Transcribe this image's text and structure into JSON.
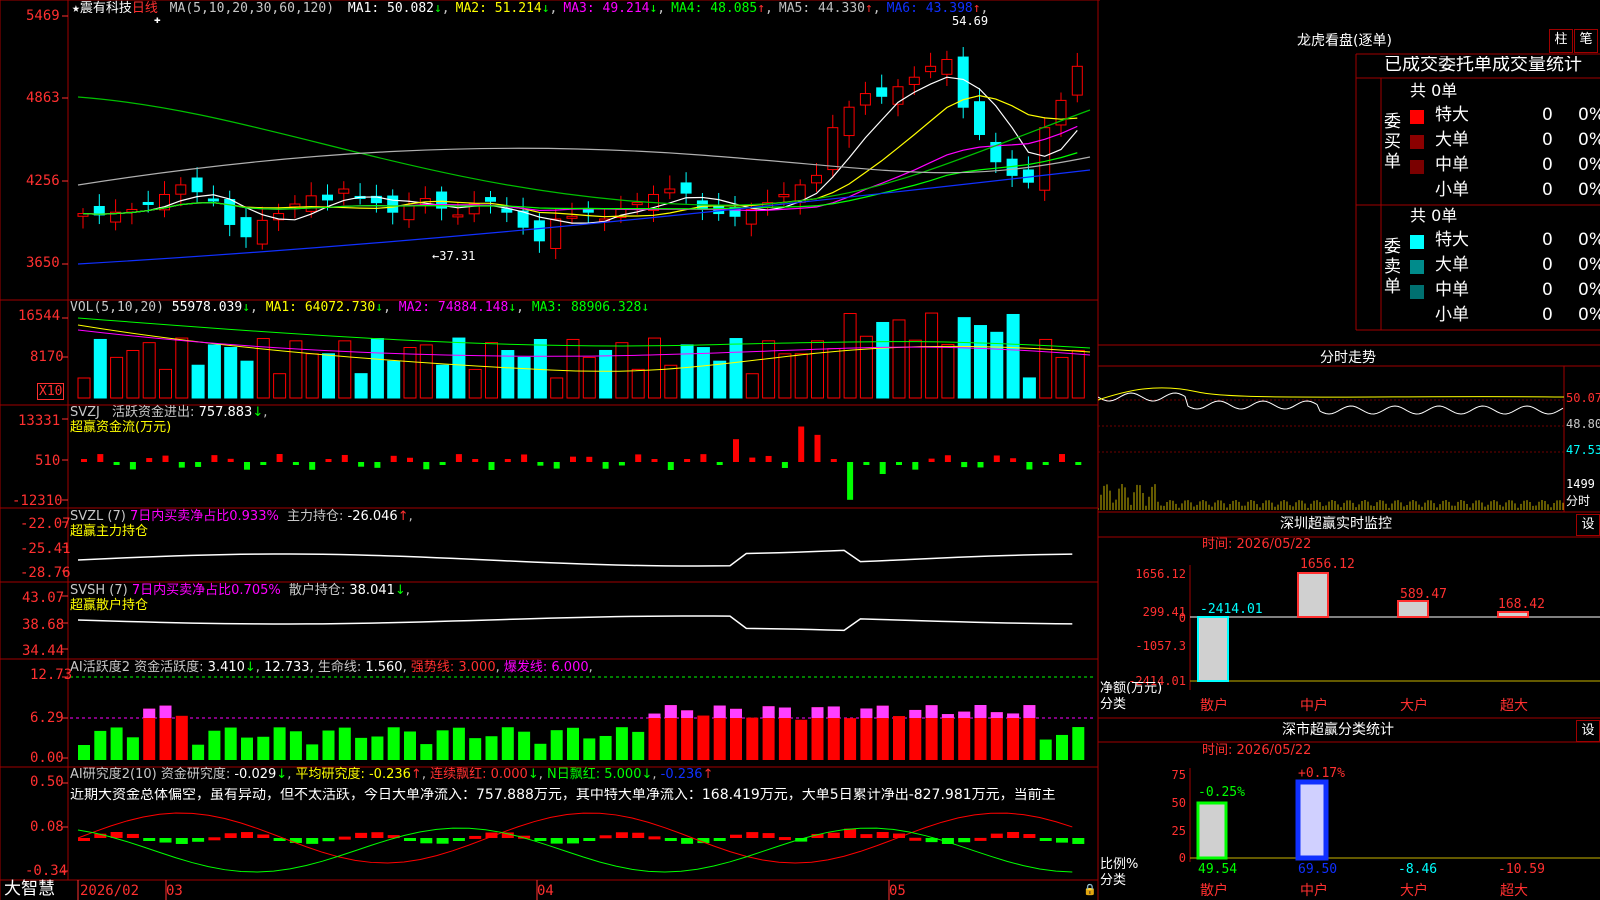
{
  "stock": {
    "name": "★震有科技",
    "period": "日线",
    "ma_spec": "MA(5,10,20,30,60,120)"
  },
  "ma": [
    {
      "label": "MA1:",
      "value": "50.082",
      "arrow": "↓",
      "color": "#ffffff"
    },
    {
      "label": "MA2:",
      "value": "51.214",
      "arrow": "↓",
      "color": "#ffff00"
    },
    {
      "label": "MA3:",
      "value": "49.214",
      "arrow": "↓",
      "color": "#ff00ff"
    },
    {
      "label": "MA4:",
      "value": "48.085",
      "arrow": "↑",
      "color": "#00ff00"
    },
    {
      "label": "MA5:",
      "value": "44.330",
      "arrow": "↑",
      "color": "#c0c0c0"
    },
    {
      "label": "MA6:",
      "value": "43.398",
      "arrow": "↑",
      "color": "#1030ff"
    }
  ],
  "price_axis": [
    "5469",
    "4863",
    "4256",
    "3650"
  ],
  "price_high_label": "54.69",
  "price_low_label": "←37.31",
  "vol": {
    "spec": "VOL(5,10,20)",
    "value": "55978.039",
    "arrow": "↓",
    "ma1": "MA1: 64072.730",
    "ma1_arrow": "↓",
    "ma2": "MA2: 74884.148",
    "ma2_arrow": "↓",
    "ma3": "MA3: 88906.328",
    "ma3_arrow": "↓",
    "axis": [
      "16544",
      "8170"
    ],
    "unit": "X10"
  },
  "svzj": {
    "title": "SVZJ",
    "label": "活跃资金进出:",
    "value": "757.883",
    "arrow": "↓",
    "subtitle": "超赢资金流(万元)",
    "axis": [
      "13331",
      "510",
      "-12310"
    ]
  },
  "svzl": {
    "title": "SVZL (7)",
    "label": "7日内买卖净占比0.933%",
    "label2": "主力持仓:",
    "value": "-26.046",
    "arrow": "↑",
    "subtitle": "超赢主力持仓",
    "axis": [
      "-22.07",
      "-25.41",
      "-28.76"
    ]
  },
  "svsh": {
    "title": "SVSH (7)",
    "label": "7日内买卖净占比0.705%",
    "label2": "散户持仓:",
    "value": "38.041",
    "arrow": "↓",
    "subtitle": "超赢散户持仓",
    "axis": [
      "43.07",
      "38.68",
      "34.44"
    ]
  },
  "ai1": {
    "title": "AI活跃度2",
    "label": "资金活跃度:",
    "value": "3.410",
    "arrow": "↓",
    "v2": "12.733",
    "label3": "生命线:",
    "v3": "1.560",
    "label4": "强势线:",
    "v4": "3.000",
    "label5": "爆发线:",
    "v5": "6.000",
    "axis": [
      "12.73",
      "6.29",
      "0.00"
    ]
  },
  "ai2": {
    "title": "AI研究度2(10)",
    "label": "资金研究度:",
    "value": "-0.029",
    "arrow": "↓",
    "label2": "平均研究度:",
    "v2": "-0.236",
    "label3": "连续飘红:",
    "v3": "0.000",
    "label4": "N日飘红:",
    "v4": "5.000",
    "v5": "-0.236",
    "axis": [
      "0.50",
      "0.08",
      "-0.34"
    ],
    "comment": "近期大资金总体偏空，虽有异动，但不太活跃，今日大单净流入：757.888万元，其中特大单净流入：168.419万元，大单5日累计净出-827.981万元，当前主"
  },
  "dates": {
    "brand": "大智慧",
    "d1": "2026/02",
    "d2": "03",
    "d3": "04",
    "d4": "05"
  },
  "longhu": {
    "title": "龙虎看盘(逐单)",
    "btn1": "柱",
    "btn2": "笔",
    "tabs": "已成交委托单成交量统计",
    "buy": {
      "side": "委买单",
      "total": "共 0单",
      "rows": [
        {
          "name": "特大",
          "n": "0",
          "p": "0%"
        },
        {
          "name": "大单",
          "n": "0",
          "p": "0%"
        },
        {
          "name": "中单",
          "n": "0",
          "p": "0%"
        },
        {
          "name": "小单",
          "n": "0",
          "p": "0%"
        }
      ]
    },
    "sell": {
      "side": "委卖单",
      "total": "共 0单",
      "rows": [
        {
          "name": "特大",
          "n": "0",
          "p": "0%"
        },
        {
          "name": "大单",
          "n": "0",
          "p": "0%"
        },
        {
          "name": "中单",
          "n": "0",
          "p": "0%"
        },
        {
          "name": "小单",
          "n": "0",
          "p": "0%"
        }
      ]
    }
  },
  "fenshi": {
    "title": "分时走势",
    "axis": [
      "50.07",
      "48.80",
      "47.53"
    ],
    "vol_axis": [
      "1499",
      "分时"
    ]
  },
  "monitor": {
    "title": "深圳超赢实时监控",
    "btn": "设",
    "time": "时间: 2026/05/22",
    "axis": [
      "1656.12",
      "299.41",
      "0",
      "-1057.3",
      "-2414.01"
    ],
    "ylabel": "净额(万元)",
    "xlabel": "分类",
    "categories": [
      "散户",
      "中户",
      "大户",
      "超大"
    ],
    "values_text": [
      "-2414.01",
      "1656.12",
      "589.47",
      "168.42"
    ]
  },
  "classify": {
    "title": "深市超赢分类统计",
    "btn": "设",
    "time": "时间: 2026/05/22",
    "axis": [
      "75",
      "50",
      "25",
      "0"
    ],
    "ylabel": "比例%",
    "xlabel": "分类",
    "categories": [
      "散户",
      "中户",
      "大户",
      "超大"
    ],
    "top_text": [
      "-0.25%",
      "+0.17%"
    ],
    "bottom_text": [
      "49.54",
      "69.50",
      "-8.46",
      "-10.59"
    ]
  },
  "colors": {
    "up": "#ff0000",
    "down": "#00ffff",
    "border": "#a00000",
    "axis_text": "#ff4040",
    "yellow": "#ffff00"
  }
}
